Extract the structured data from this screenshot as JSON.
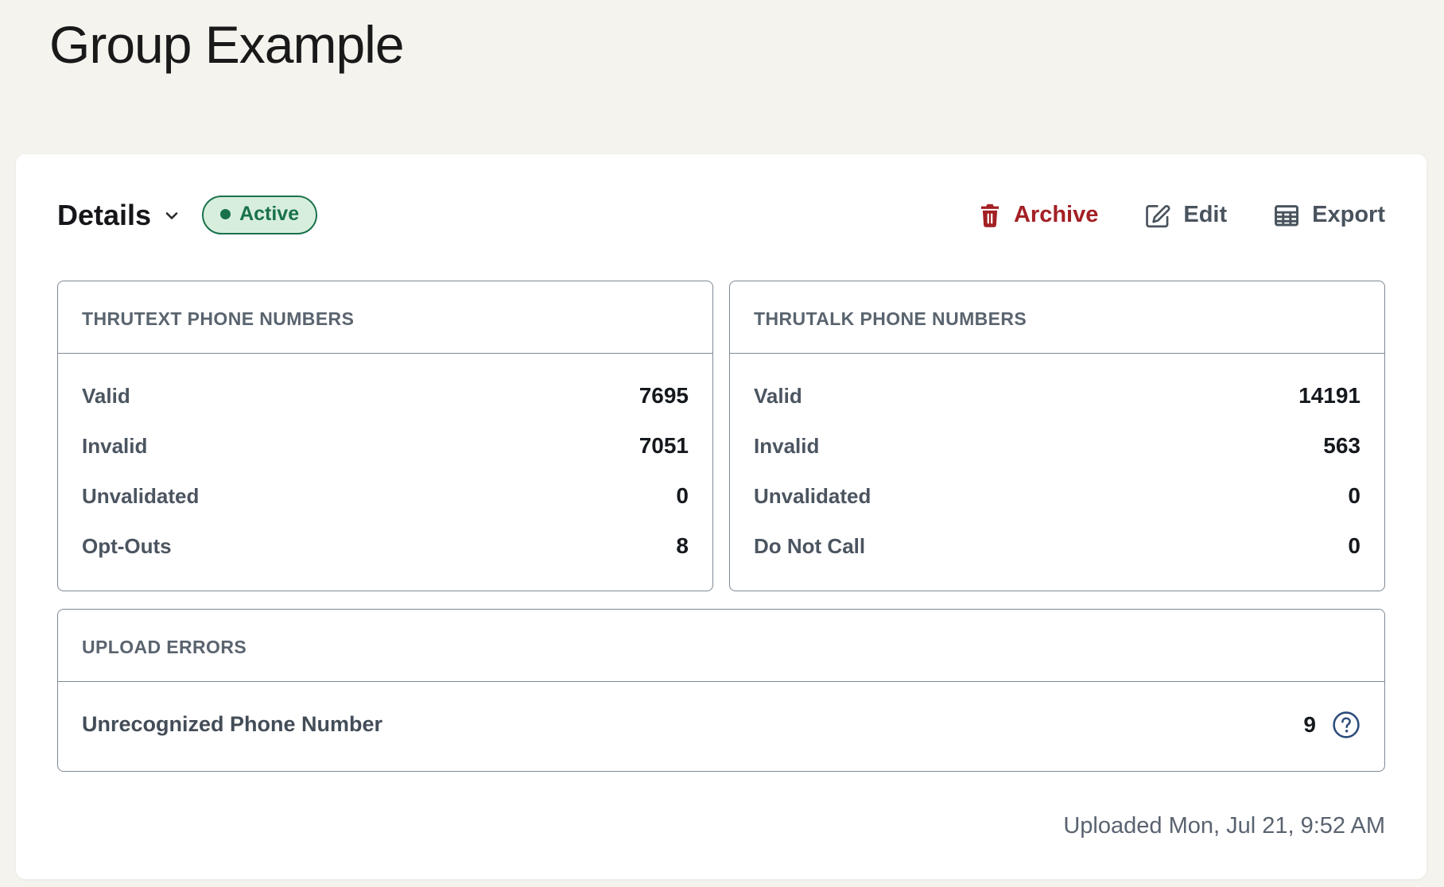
{
  "page": {
    "title": "Group Example"
  },
  "toolbar": {
    "details_label": "Details",
    "status": {
      "label": "Active"
    },
    "actions": {
      "archive": "Archive",
      "edit": "Edit",
      "export": "Export"
    }
  },
  "cards": {
    "thrutext": {
      "header": "THRUTEXT PHONE NUMBERS",
      "rows": [
        {
          "label": "Valid",
          "value": "7695"
        },
        {
          "label": "Invalid",
          "value": "7051"
        },
        {
          "label": "Unvalidated",
          "value": "0"
        },
        {
          "label": "Opt-Outs",
          "value": "8"
        }
      ]
    },
    "thrutalk": {
      "header": "THRUTALK PHONE NUMBERS",
      "rows": [
        {
          "label": "Valid",
          "value": "14191"
        },
        {
          "label": "Invalid",
          "value": "563"
        },
        {
          "label": "Unvalidated",
          "value": "0"
        },
        {
          "label": "Do Not Call",
          "value": "0"
        }
      ]
    },
    "upload_errors": {
      "header": "UPLOAD ERRORS",
      "row": {
        "label": "Unrecognized Phone Number",
        "value": "9"
      }
    }
  },
  "footer": {
    "uploaded": "Uploaded Mon, Jul 21, 9:52 AM"
  },
  "icons": {
    "chevron": "chevron-down",
    "archive": "trash",
    "edit": "pencil-square",
    "export": "table",
    "help": "question-circle"
  },
  "colors": {
    "page_bg": "#f5f3ee",
    "panel_bg": "#ffffff",
    "border_gray": "#7f8993",
    "header_text": "#5a646f",
    "label_text": "#4b5560",
    "value_text": "#15191e",
    "red": "#a32025",
    "green_dark": "#19714c",
    "green_bg": "#d8eedd",
    "navy": "#2e4d7b",
    "muted_text": "#5a6370",
    "title_text": "#191919",
    "action_text": "#49535e"
  }
}
